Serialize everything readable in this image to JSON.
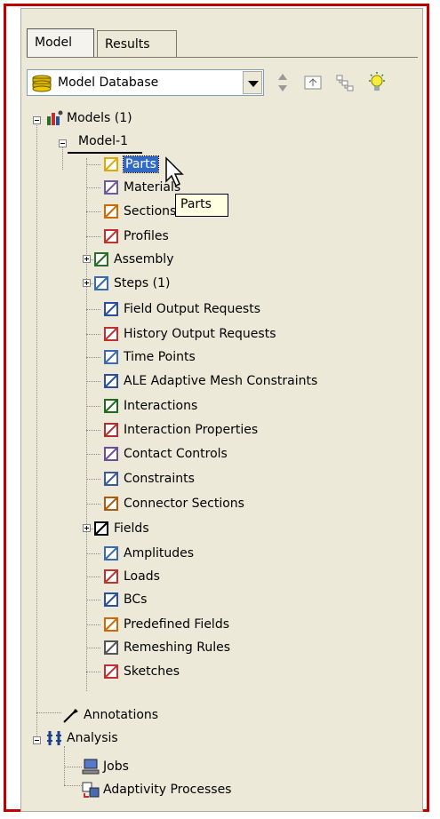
{
  "tabs": [
    {
      "label": "Model",
      "active": true
    },
    {
      "label": "Results",
      "active": false
    }
  ],
  "toolbar": {
    "database_combo": "Model Database"
  },
  "tree": {
    "root": {
      "label": "Models (1)"
    },
    "model": {
      "label": "Model-1"
    },
    "items": [
      {
        "label": "Parts",
        "icon": "part-icon",
        "selected": true
      },
      {
        "label": "Materials",
        "icon": "material-icon"
      },
      {
        "label": "Sections",
        "icon": "section-icon"
      },
      {
        "label": "Profiles",
        "icon": "profile-icon"
      },
      {
        "label": "Assembly",
        "icon": "assembly-icon",
        "expandable": true
      },
      {
        "label": "Steps (1)",
        "icon": "steps-icon",
        "expandable": true
      },
      {
        "label": "Field Output Requests",
        "icon": "field-output-icon"
      },
      {
        "label": "History Output Requests",
        "icon": "history-output-icon"
      },
      {
        "label": "Time Points",
        "icon": "time-points-icon"
      },
      {
        "label": "ALE Adaptive Mesh Constraints",
        "icon": "ale-mesh-icon"
      },
      {
        "label": "Interactions",
        "icon": "interaction-icon"
      },
      {
        "label": "Interaction Properties",
        "icon": "interaction-property-icon"
      },
      {
        "label": "Contact Controls",
        "icon": "contact-controls-icon"
      },
      {
        "label": "Constraints",
        "icon": "constraint-icon"
      },
      {
        "label": "Connector Sections",
        "icon": "connector-section-icon"
      },
      {
        "label": "Fields",
        "icon": "fields-icon",
        "expandable": true
      },
      {
        "label": "Amplitudes",
        "icon": "amplitude-icon"
      },
      {
        "label": "Loads",
        "icon": "load-icon"
      },
      {
        "label": "BCs",
        "icon": "bc-icon"
      },
      {
        "label": "Predefined Fields",
        "icon": "predefined-field-icon"
      },
      {
        "label": "Remeshing Rules",
        "icon": "remeshing-icon"
      },
      {
        "label": "Sketches",
        "icon": "sketch-icon"
      }
    ],
    "annotations": {
      "label": "Annotations"
    },
    "analysis": {
      "label": "Analysis",
      "children": [
        {
          "label": "Jobs",
          "icon": "jobs-icon"
        },
        {
          "label": "Adaptivity Processes",
          "icon": "adaptivity-icon"
        }
      ]
    }
  },
  "tooltip": {
    "text": "Parts"
  },
  "colors": {
    "selection": "#316ac5",
    "frame": "#c00000",
    "panel": "#ece9d8",
    "tooltip": "#ffffe1"
  }
}
